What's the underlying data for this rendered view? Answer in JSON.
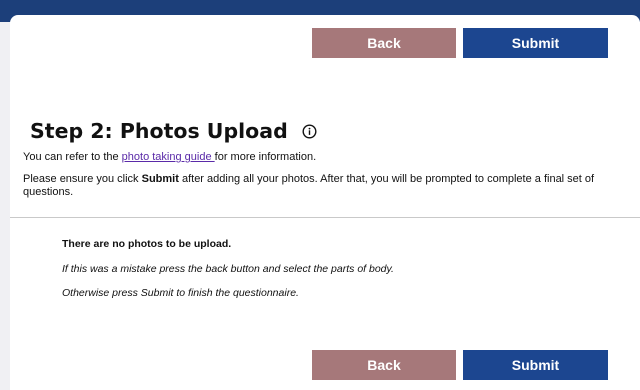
{
  "nav": {
    "back_label": "Back",
    "submit_label": "Submit"
  },
  "step": {
    "title": "Step 2: Photos Upload"
  },
  "intro": {
    "line1_prefix": "You can refer to the ",
    "guide_link": "photo taking guide ",
    "line1_suffix": "for more information.",
    "line2_prefix": "Please ensure you click ",
    "line2_bold": "Submit",
    "line2_suffix": " after adding all your photos. After that, you will be prompted to complete a final set of questions."
  },
  "messages": {
    "no_photos": "There are no photos to be upload.",
    "mistake_hint": "If this was a mistake press the back button and select the parts of body.",
    "finish_hint": "Otherwise press Submit to finish the questionnaire."
  },
  "colors": {
    "header_band": "#1c3f7a",
    "back_button": "#a6787a",
    "submit_button": "#1c4690",
    "link": "#5a2aa8"
  },
  "icons": {
    "title_info": "info-circle-icon"
  }
}
